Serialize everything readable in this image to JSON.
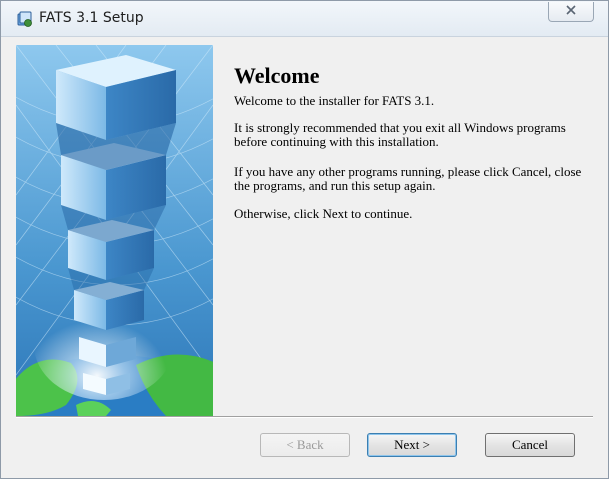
{
  "window": {
    "title": "FATS 3.1 Setup"
  },
  "content": {
    "heading": "Welcome",
    "paragraphs": [
      "Welcome to the installer for FATS 3.1.",
      "It is strongly recommended that you exit all Windows programs before continuing with this installation.",
      "If you have any other programs running, please click Cancel, close the programs, and run this setup again.",
      "Otherwise, click Next to continue."
    ]
  },
  "buttons": {
    "back": "< Back",
    "next": "Next >",
    "cancel": "Cancel"
  },
  "icons": {
    "app": "installer-icon",
    "close": "close-icon"
  },
  "colors": {
    "banner_sky": "#5ba3d6",
    "default_button_border": "#3c7fb1"
  }
}
